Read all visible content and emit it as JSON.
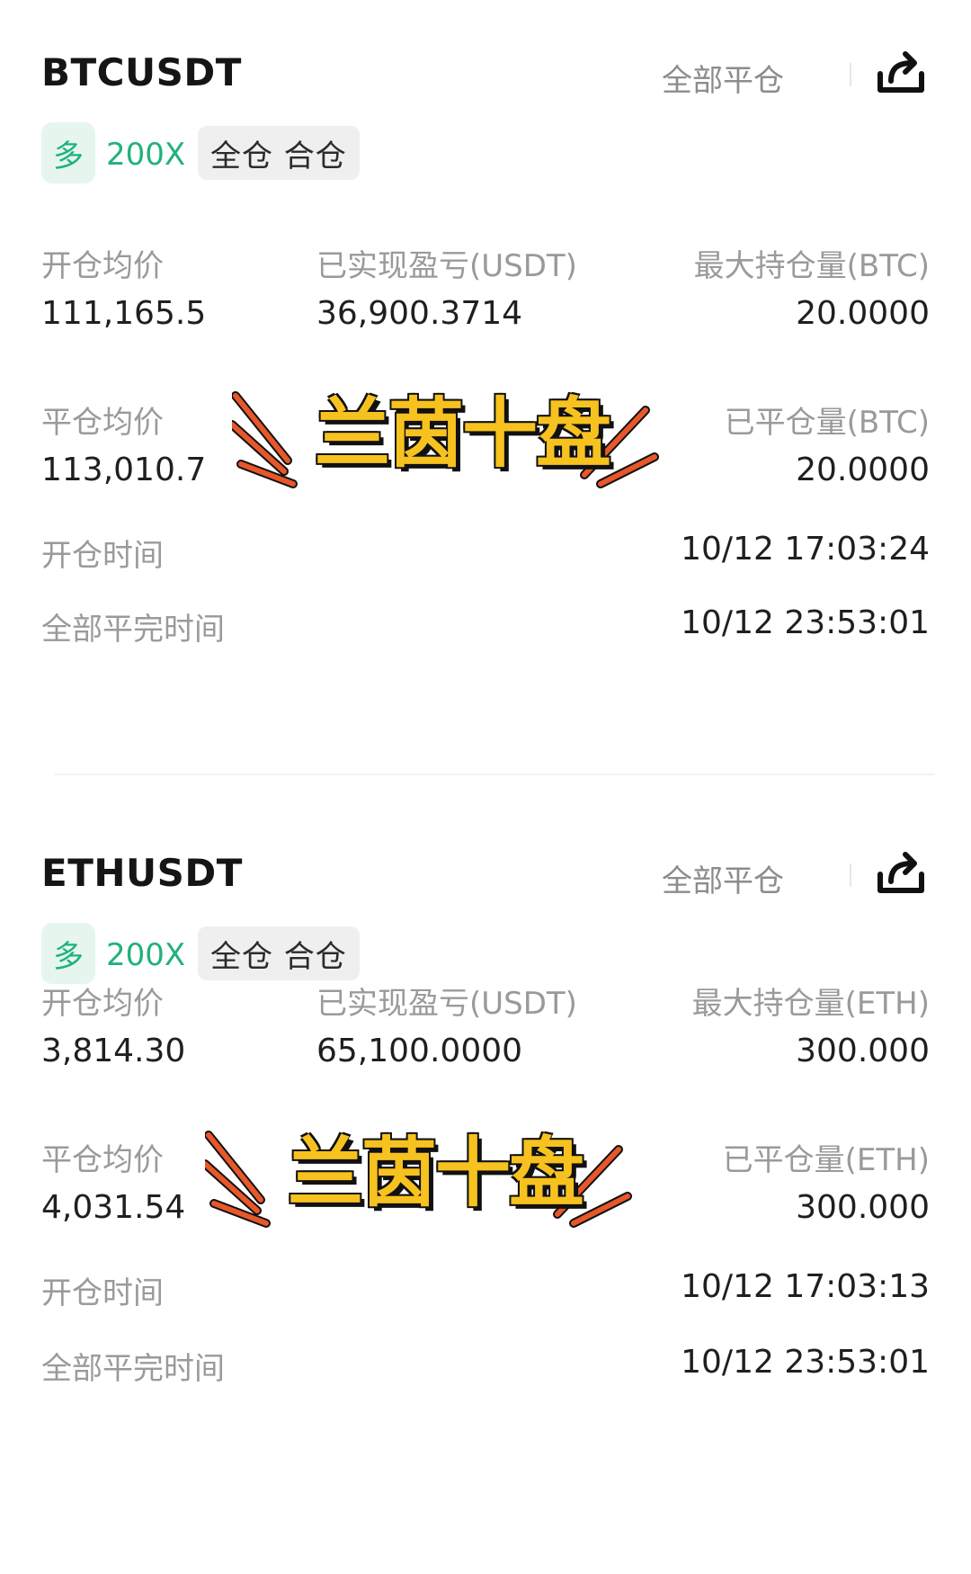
{
  "positions": [
    {
      "symbol": "BTCUSDT",
      "close_all_label": "全部平仓",
      "share_icon": "share-icon",
      "side": "多",
      "leverage": "200X",
      "margin_mode": "全仓 合仓",
      "open_avg_label": "开仓均价",
      "open_avg_value": "111,165.5",
      "realized_pnl_label": "已实现盈亏(USDT)",
      "realized_pnl_value": "36,900.3714",
      "max_position_label": "最大持仓量(BTC)",
      "max_position_value": "20.0000",
      "close_avg_label": "平仓均价",
      "close_avg_value": "113,010.7",
      "closed_amount_label": "已平仓量(BTC)",
      "closed_amount_value": "20.0000",
      "open_time_label": "开仓时间",
      "open_time_value": "10/12 17:03:24",
      "full_close_time_label": "全部平完时间",
      "full_close_time_value": "10/12 23:53:01",
      "watermark_text": "兰茵十盘"
    },
    {
      "symbol": "ETHUSDT",
      "close_all_label": "全部平仓",
      "share_icon": "share-icon",
      "side": "多",
      "leverage": "200X",
      "margin_mode": "全仓 合仓",
      "open_avg_label": "开仓均价",
      "open_avg_value": "3,814.30",
      "realized_pnl_label": "已实现盈亏(USDT)",
      "realized_pnl_value": "65,100.0000",
      "max_position_label": "最大持仓量(ETH)",
      "max_position_value": "300.000",
      "close_avg_label": "平仓均价",
      "close_avg_value": "4,031.54",
      "closed_amount_label": "已平仓量(ETH)",
      "closed_amount_value": "300.000",
      "open_time_label": "开仓时间",
      "open_time_value": "10/12 17:03:13",
      "full_close_time_label": "全部平完时间",
      "full_close_time_value": "10/12 23:53:01",
      "watermark_text": "兰茵十盘"
    }
  ],
  "colors": {
    "long_green": "#20b27a",
    "long_green_bg": "#e6f6ef",
    "watermark_yellow": "#f7c21f",
    "watermark_orange": "#e8572a"
  }
}
